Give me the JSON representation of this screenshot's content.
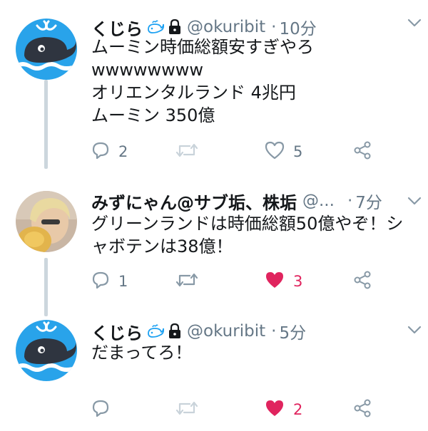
{
  "tweets": [
    {
      "display_name": "くじら",
      "handle": "@okuribit",
      "separator": "·",
      "time": "10分",
      "lines": [
        "ムーミン時価総額安すぎやろ",
        "wwwwwwww",
        "オリエンタルランド 4兆円",
        "ムーミン 350億"
      ],
      "reply_count": "2",
      "retweet_count": "",
      "like_count": "5",
      "liked": false
    },
    {
      "display_name": "みずにゃん@サブ垢、株垢",
      "handle": "@...",
      "separator": "·",
      "time": "7分",
      "lines": [
        "グリーンランドは時価総額50億やぞ！シ",
        "ャボテンは38億！"
      ],
      "reply_count": "1",
      "retweet_count": "",
      "like_count": "3",
      "liked": true
    },
    {
      "display_name": "くじら",
      "handle": "@okuribit",
      "separator": "·",
      "time": "5分",
      "lines": [
        "だまってろ！"
      ],
      "reply_count": "",
      "retweet_count": "",
      "like_count": "2",
      "liked": true
    }
  ],
  "colors": {
    "text": "#14171a",
    "secondary": "#657786",
    "icon": "#8899a6",
    "like_active": "#e0245e",
    "connector": "#ccd6dd",
    "whale_bg": "#1da1f2"
  },
  "icons": {
    "badge": "whale-emoji-icon",
    "protected": "lock-icon",
    "menu": "chevron-down-icon",
    "reply": "reply-icon",
    "retweet": "retweet-icon",
    "like": "heart-icon",
    "share": "share-icon"
  }
}
